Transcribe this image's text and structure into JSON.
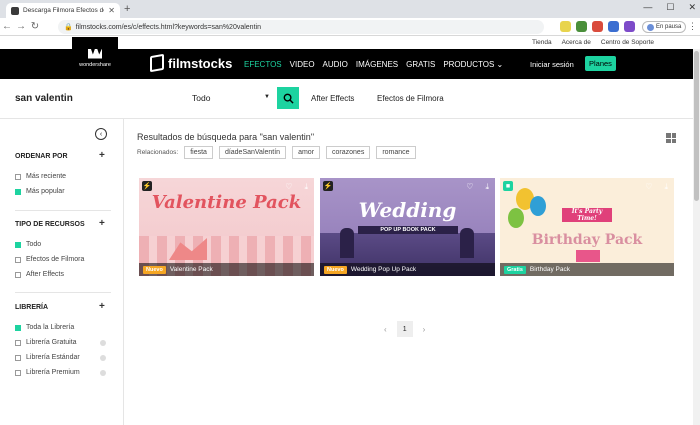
{
  "browser": {
    "tab_title": "Descarga Filmora Efectos de Vid...",
    "url": "filmstocks.com/es/c/effects.html?keywords=san%20valentin",
    "profile_label": "En pausa"
  },
  "util_links": [
    "Tienda",
    "Acerca de",
    "Centro de Soporte"
  ],
  "brand": {
    "wondershare": "wondershare",
    "filmstocks": "filmstocks"
  },
  "nav": {
    "items": [
      "EFECTOS",
      "VIDEO",
      "AUDIO",
      "IMÁGENES",
      "GRATIS",
      "PRODUCTOS"
    ],
    "login": "Iniciar sesión",
    "plans": "Planes"
  },
  "search": {
    "query": "san valentin",
    "category": "Todo",
    "filters": [
      "After Effects",
      "Efectos de Filmora"
    ]
  },
  "sidebar": {
    "sections": [
      {
        "title": "ORDENAR POR",
        "options": [
          {
            "label": "Más reciente",
            "checked": false
          },
          {
            "label": "Más popular",
            "checked": true
          }
        ]
      },
      {
        "title": "TIPO DE RECURSOS",
        "options": [
          {
            "label": "Todo",
            "checked": true
          },
          {
            "label": "Efectos de Filmora",
            "checked": false
          },
          {
            "label": "After Effects",
            "checked": false
          }
        ]
      },
      {
        "title": "LIBRERÍA",
        "options": [
          {
            "label": "Toda la Librería",
            "checked": true
          },
          {
            "label": "Librería Gratuita",
            "checked": false
          },
          {
            "label": "Librería Estándar",
            "checked": false
          },
          {
            "label": "Librería Premium",
            "checked": false
          }
        ]
      }
    ]
  },
  "results": {
    "heading": "Resultados de búsqueda para \"san valentin\"",
    "related_label": "Relacionados:",
    "related": [
      "fiesta",
      "díadeSanValentín",
      "amor",
      "corazones",
      "romance"
    ],
    "cards": [
      {
        "badge": "Nuevo",
        "name": "Valentine Pack",
        "art_title": "Valentine Pack"
      },
      {
        "badge": "Nuevo",
        "name": "Wedding Pop Up Pack",
        "art_title": "Wedding",
        "art_sub": "POP UP BOOK PACK"
      },
      {
        "badge": "Gratis",
        "name": "Birthday Pack",
        "art_title": "Birthday Pack",
        "art_sub": "It's Party Time!"
      }
    ]
  },
  "pagination": {
    "current": "1"
  },
  "colors": {
    "accent": "#1dd3a0",
    "nav_bg": "#000000",
    "new_badge": "#f5a623"
  }
}
